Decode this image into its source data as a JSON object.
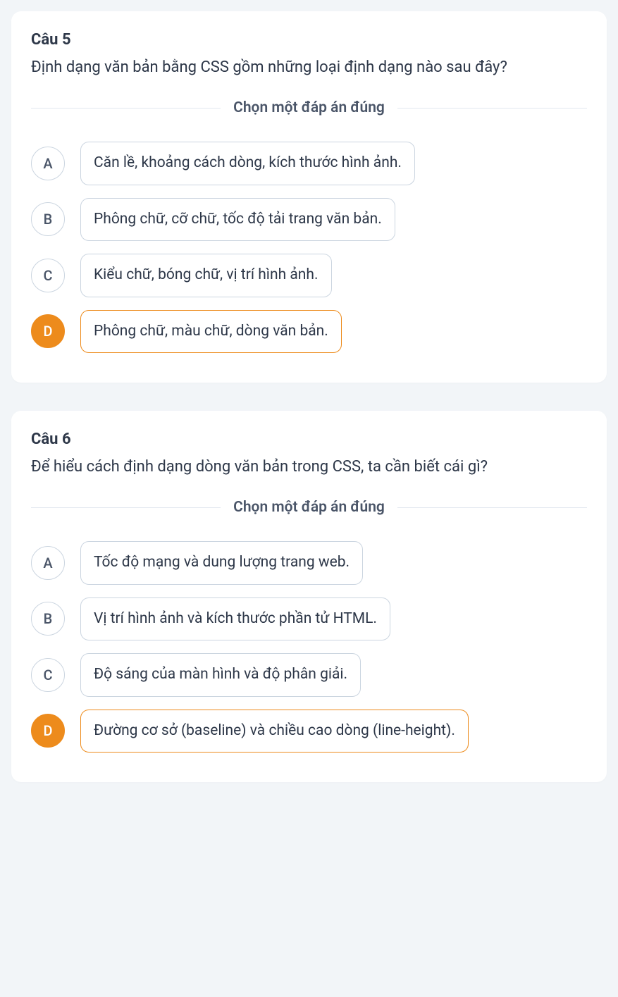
{
  "questions": [
    {
      "number": "Câu 5",
      "text": "Định dạng văn bản bằng CSS gồm những loại định dạng nào sau đây?",
      "instruction": "Chọn một đáp án đúng",
      "options": [
        {
          "letter": "A",
          "text": "Căn lề, khoảng cách dòng, kích thước hình ảnh.",
          "selected": false
        },
        {
          "letter": "B",
          "text": "Phông chữ, cỡ chữ, tốc độ tải trang văn bản.",
          "selected": false
        },
        {
          "letter": "C",
          "text": "Kiểu chữ, bóng chữ, vị trí hình ảnh.",
          "selected": false
        },
        {
          "letter": "D",
          "text": "Phông chữ, màu chữ, dòng văn bản.",
          "selected": true
        }
      ]
    },
    {
      "number": "Câu 6",
      "text": "Để hiểu cách định dạng dòng văn bản trong CSS, ta cần biết cái gì?",
      "instruction": "Chọn một đáp án đúng",
      "options": [
        {
          "letter": "A",
          "text": "Tốc độ mạng và dung lượng trang web.",
          "selected": false
        },
        {
          "letter": "B",
          "text": "Vị trí hình ảnh và kích thước phần tử HTML.",
          "selected": false
        },
        {
          "letter": "C",
          "text": "Độ sáng của màn hình và độ phân giải.",
          "selected": false
        },
        {
          "letter": "D",
          "text": "Đường cơ sở (baseline) và chiều cao dòng (line-height).",
          "selected": true
        }
      ]
    }
  ]
}
